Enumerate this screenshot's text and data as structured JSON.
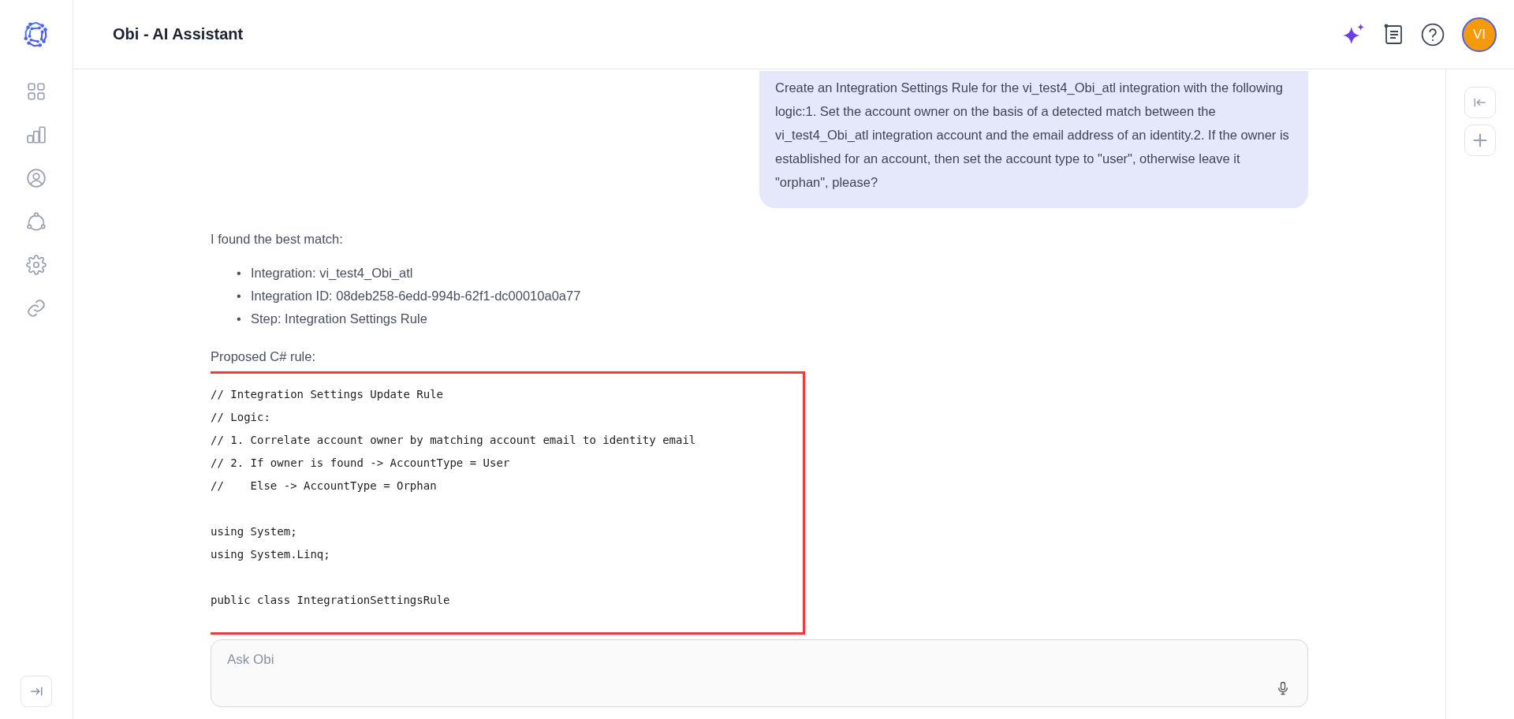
{
  "app": {
    "title": "Obi - AI Assistant"
  },
  "header": {
    "avatar": "VI"
  },
  "messages": [
    {
      "kind": "question",
      "text": "Create an Integration Settings Rule for the vi_test4_Obi_atl integration with the following logic:1. Set the account owner on the basis of a detected match between the vi_test4_Obi_atl integration account and the email address of an identity.2. If the owner is established for an account, then set the account type to \"user\", otherwise leave it \"orphan\", please?"
    },
    {
      "kind": "answer",
      "intro": "I found the best match:",
      "bullets": [
        {
          "marker": "•",
          "text": "Integration: vi_test4_Obi_atl"
        },
        {
          "marker": "•",
          "text": "Integration ID: 08deb258-6edd-994b-62f1-dc00010a0a77"
        },
        {
          "marker": "•",
          "text": "Step: Integration Settings Rule"
        }
      ],
      "code_label": "Proposed C# rule:",
      "code_groups": [
        [
          "// Integration Settings Update Rule",
          "// Logic:",
          "// 1. Correlate account owner by matching account email to identity email",
          "// 2. If owner is found -> AccountType = User",
          "//    Else -> AccountType = Orphan"
        ],
        [
          "using System;",
          "using System.Linq;"
        ],
        [
          "public class IntegrationSettingsRule"
        ]
      ]
    }
  ],
  "input": {
    "placeholder": "Ask Obi"
  }
}
